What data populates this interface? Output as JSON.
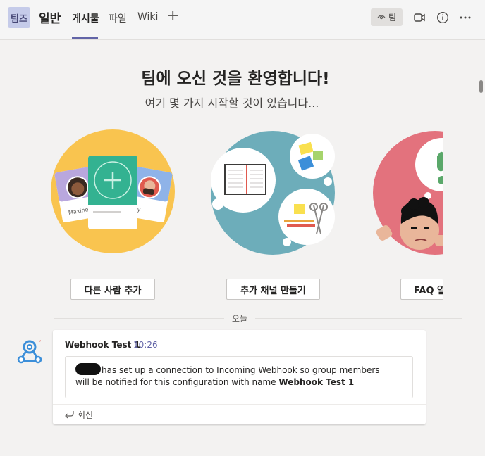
{
  "header": {
    "team_avatar": "팀즈",
    "channel_name": "일반",
    "tabs": [
      {
        "label": "게시물",
        "active": true
      },
      {
        "label": "파일",
        "active": false
      },
      {
        "label": "Wiki",
        "active": false
      }
    ],
    "add_tab_icon": "plus-icon",
    "team_pill_label": "팀",
    "team_pill_icon": "eye-icon",
    "icons": [
      "video-icon",
      "info-icon",
      "more-icon"
    ]
  },
  "welcome": {
    "title": "팀에 오신 것을 환영합니다!",
    "subtitle": "여기 몇 가지 시작할 것이 있습니다..."
  },
  "cards": [
    {
      "button": "다른 사람 추가",
      "illustration": "people-cards",
      "names": [
        "Maxine",
        "ky"
      ]
    },
    {
      "button": "추가 채널 만들기",
      "illustration": "notebook-and-supplies"
    },
    {
      "button": "FAQ 열",
      "illustration": "person-thinking"
    }
  ],
  "date_divider": "오늘",
  "message": {
    "sender": "Webhook Test 1",
    "time": "10:26",
    "avatar_icon": "webhook-icon",
    "text_main": "has set up a connection to Incoming Webhook so group members will be notified for this configuration with name",
    "text_bold": "Webhook Test 1",
    "reply_label": "회신",
    "reply_icon": "reply-arrow-icon"
  },
  "colors": {
    "brand": "#6264a7",
    "card1_bg": "#f9c44f",
    "card2_bg": "#6dadba",
    "card3_bg": "#e3727d",
    "page_bg": "#f3f2f1"
  }
}
